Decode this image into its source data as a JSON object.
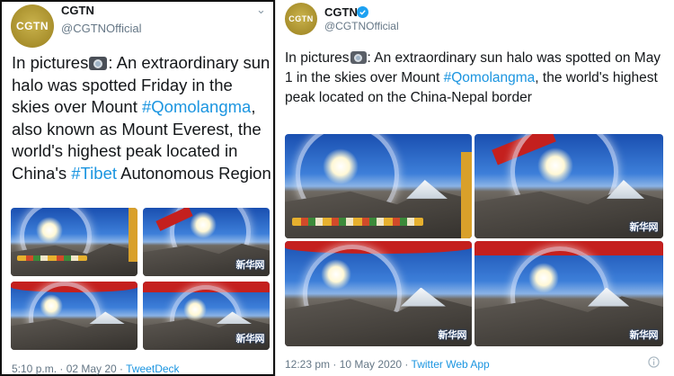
{
  "left": {
    "author_name": "CGTN",
    "handle": "@CGTNOfficial",
    "avatar_text": "CGTN",
    "text_pre": "In pictures",
    "text_mid": ": An extraordinary sun halo was spotted Friday in the skies over Mount ",
    "tag1": "#Qomolangma",
    "text_mid2": ", also known as Mount Everest, the world's highest peak located in China's ",
    "tag2": "#Tibet",
    "text_post": " Autonomous Region",
    "time": "5:10 p.m. · 02 May 20 · ",
    "source": "TweetDeck",
    "watermark": "新华网",
    "chevron_icon": "chevron-down-icon",
    "camera_icon": "camera-icon"
  },
  "right": {
    "author_name": "CGTN",
    "handle": "@CGTNOfficial",
    "avatar_text": "CGTN",
    "text_pre": "In pictures",
    "text_mid": ": An extraordinary sun halo was spotted on May 1 in the skies over Mount ",
    "tag1": "#Qomolangma",
    "text_post": ", the world's highest peak located on the China-Nepal border",
    "time": "12:23 pm · 10 May 2020 · ",
    "source": "Twitter Web App",
    "watermark": "新华网",
    "info_icon": "info-icon",
    "camera_icon": "camera-icon",
    "verified_icon": "verified-badge-icon"
  },
  "colors": {
    "link": "#1b95e0",
    "verified": "#1da1f2",
    "secondary_text": "#657786",
    "avatar_gold": "#a88f2c"
  }
}
